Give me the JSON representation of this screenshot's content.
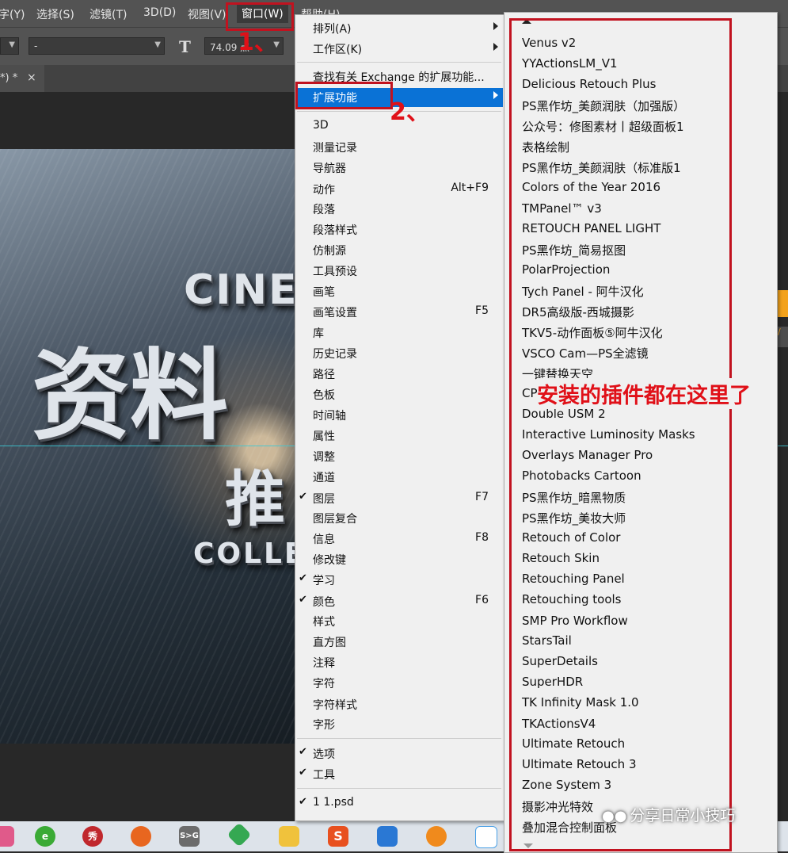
{
  "menubar": {
    "items": [
      "字(Y)",
      "选择(S)",
      "滤镜(T)",
      "3D(D)",
      "视图(V)",
      "窗口(W)",
      "帮助(H)"
    ]
  },
  "optbar": {
    "dropdown2_value": "-",
    "font_size_value": "74.09 点"
  },
  "tab": {
    "title": "*) *",
    "close": "×"
  },
  "artwork": {
    "line1": "CINEM",
    "line2": "资料",
    "line3": "推",
    "line4": "COLLE"
  },
  "window_menu": {
    "items": [
      {
        "label": "排列(A)",
        "submenu": true
      },
      {
        "label": "工作区(K)",
        "submenu": true
      },
      {
        "label": "查找有关 Exchange 的扩展功能..."
      },
      {
        "label": "扩展功能",
        "submenu": true,
        "highlighted": true
      },
      {
        "label": "3D"
      },
      {
        "label": "测量记录"
      },
      {
        "label": "导航器"
      },
      {
        "label": "动作",
        "shortcut": "Alt+F9"
      },
      {
        "label": "段落"
      },
      {
        "label": "段落样式"
      },
      {
        "label": "仿制源"
      },
      {
        "label": "工具预设"
      },
      {
        "label": "画笔"
      },
      {
        "label": "画笔设置",
        "shortcut": "F5"
      },
      {
        "label": "库"
      },
      {
        "label": "历史记录"
      },
      {
        "label": "路径"
      },
      {
        "label": "色板"
      },
      {
        "label": "时间轴"
      },
      {
        "label": "属性"
      },
      {
        "label": "调整"
      },
      {
        "label": "通道"
      },
      {
        "label": "图层",
        "shortcut": "F7",
        "checked": true
      },
      {
        "label": "图层复合"
      },
      {
        "label": "信息",
        "shortcut": "F8"
      },
      {
        "label": "修改键"
      },
      {
        "label": "学习",
        "checked": true
      },
      {
        "label": "颜色",
        "shortcut": "F6",
        "checked": true
      },
      {
        "label": "样式"
      },
      {
        "label": "直方图"
      },
      {
        "label": "注释"
      },
      {
        "label": "字符"
      },
      {
        "label": "字符样式"
      },
      {
        "label": "字形"
      },
      {
        "label": "选项",
        "checked": true
      },
      {
        "label": "工具",
        "checked": true
      },
      {
        "label": "1 1.psd",
        "checked": true
      }
    ],
    "checkmark": "✔"
  },
  "extensions_menu": {
    "items": [
      "Venus v2",
      "YYActionsLM_V1",
      "Delicious Retouch Plus",
      "PS黑作坊_美颜润肤（加强版）",
      "公众号：修图素材丨超级面板1",
      "表格绘制",
      "PS黑作坊_美颜润肤（标准版1",
      "Colors of the Year 2016",
      "TMPanel™ v3",
      "RETOUCH PANEL LIGHT",
      "PS黑作坊_简易抠图",
      "PolarProjection",
      "Tych Panel - 阿牛汉化",
      "DR5高级版-西城摄影",
      "TKV5-动作面板⑤阿牛汉化",
      "VSCO Cam—PS全滤镜",
      "一键替换天空",
      "CP",
      "Double USM 2",
      "Interactive Luminosity Masks",
      "Overlays Manager Pro",
      "Photobacks Cartoon",
      "PS黑作坊_暗黑物质",
      "PS黑作坊_美妆大师",
      "Retouch of Color",
      "Retouch Skin",
      "Retouching Panel",
      "Retouching tools",
      "SMP Pro Workflow",
      "StarsTail",
      "SuperDetails",
      "SuperHDR",
      "TK Infinity Mask 1.0",
      "TKActionsV4",
      "Ultimate Retouch",
      "Ultimate Retouch 3",
      "Zone System 3",
      "摄影冲光特效",
      "叠加混合控制面板"
    ]
  },
  "annotations": {
    "step1": "1、",
    "step2": "2、",
    "note": "安装的插件都在这里了",
    "color": "#c1121f"
  },
  "watermark": "分享日常小技巧",
  "taskbar": {
    "icons": [
      "app-icon",
      "ie-icon",
      "xiu-icon",
      "firefox-icon",
      "sxg-icon",
      "green-app-icon",
      "folder-icon",
      "sogou-icon",
      "tools-icon",
      "search-icon",
      "network-icon"
    ],
    "labels": {
      "xiu": "秀",
      "sxg": "S>G",
      "sogou": "S"
    }
  },
  "right_panel": {
    "snippet": "u/"
  }
}
